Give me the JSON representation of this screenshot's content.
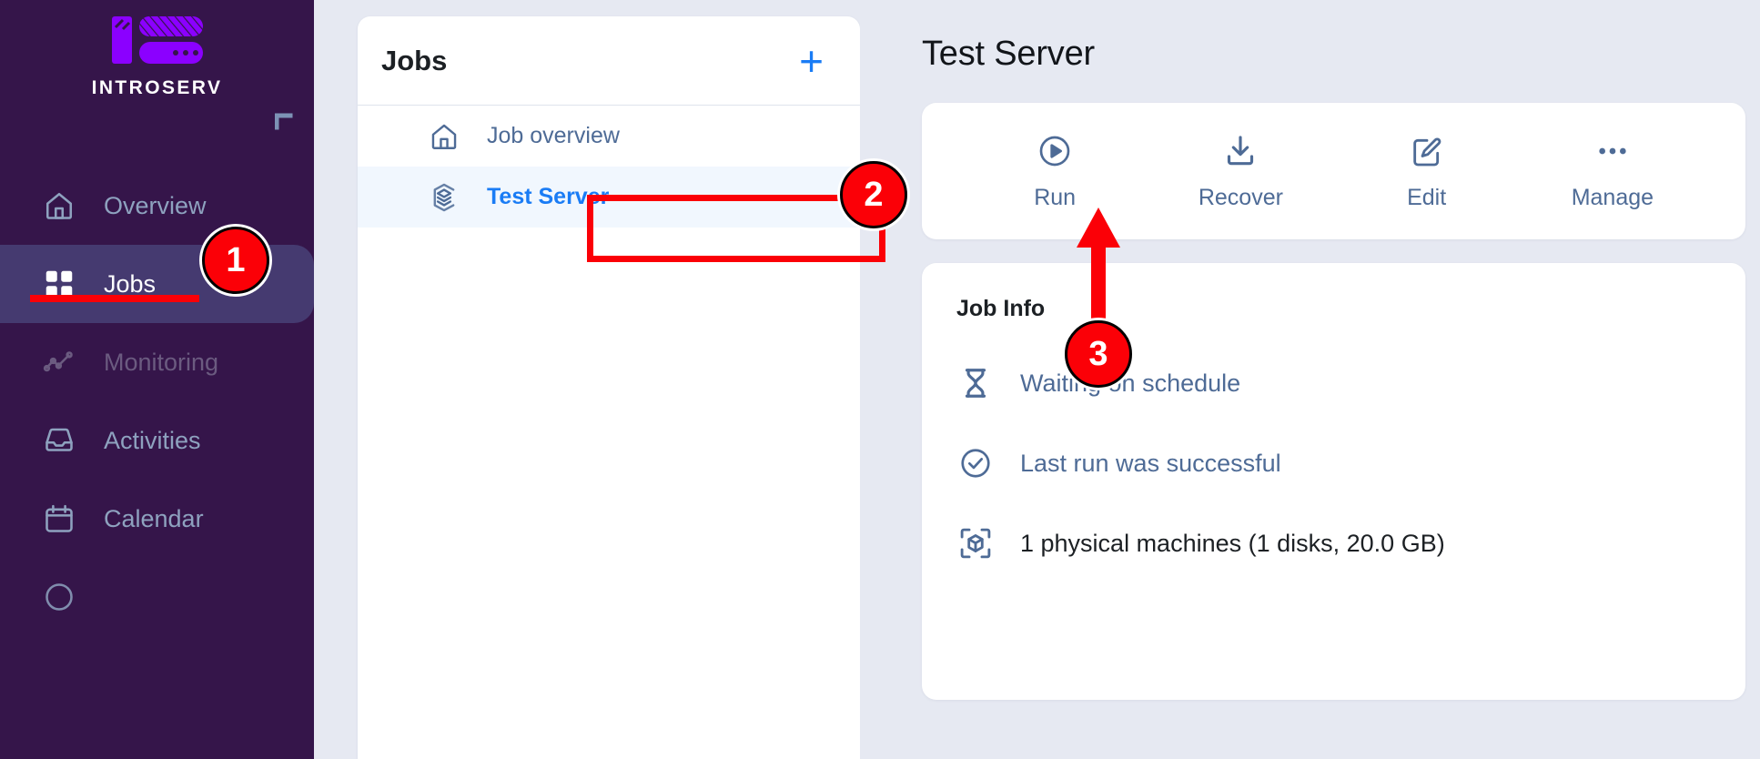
{
  "brand": {
    "name": "INTROSERV",
    "logo_icon": "server-rack-logo",
    "accent": "#8b00ff"
  },
  "sidebar": {
    "collapse_icon": "corner-bracket-icon",
    "items": [
      {
        "label": "Overview",
        "icon": "home-icon",
        "state": "normal"
      },
      {
        "label": "Jobs",
        "icon": "grid-icon",
        "state": "active"
      },
      {
        "label": "Monitoring",
        "icon": "line-chart-icon",
        "state": "muted"
      },
      {
        "label": "Activities",
        "icon": "inbox-icon",
        "state": "normal"
      },
      {
        "label": "Calendar",
        "icon": "calendar-icon",
        "state": "normal"
      }
    ]
  },
  "jobs_panel": {
    "title": "Jobs",
    "add_label": "+",
    "add_icon": "plus-icon",
    "rows": [
      {
        "label": "Job overview",
        "icon": "home-icon",
        "selected": false
      },
      {
        "label": "Test Server",
        "icon": "layers-hex-icon",
        "selected": true
      }
    ]
  },
  "main": {
    "page_title": "Test Server",
    "actions": [
      {
        "label": "Run",
        "icon": "play-circle-icon"
      },
      {
        "label": "Recover",
        "icon": "download-icon"
      },
      {
        "label": "Edit",
        "icon": "edit-square-icon"
      },
      {
        "label": "Manage",
        "icon": "ellipsis-icon"
      }
    ],
    "info": {
      "title": "Job Info",
      "rows": [
        {
          "text": "Waiting on schedule",
          "icon": "hourglass-icon",
          "tone": "link"
        },
        {
          "text": "Last run was successful",
          "icon": "check-circle-icon",
          "tone": "link"
        },
        {
          "text": "1 physical machines (1 disks, 20.0 GB)",
          "icon": "cube-scan-icon",
          "tone": "dark"
        }
      ]
    }
  },
  "annotations": {
    "color": "#fb0007",
    "markers": [
      {
        "number": "1",
        "target": "sidebar-item-jobs"
      },
      {
        "number": "2",
        "target": "jobs-row-test-server"
      },
      {
        "number": "3",
        "target": "action-recover"
      }
    ]
  }
}
